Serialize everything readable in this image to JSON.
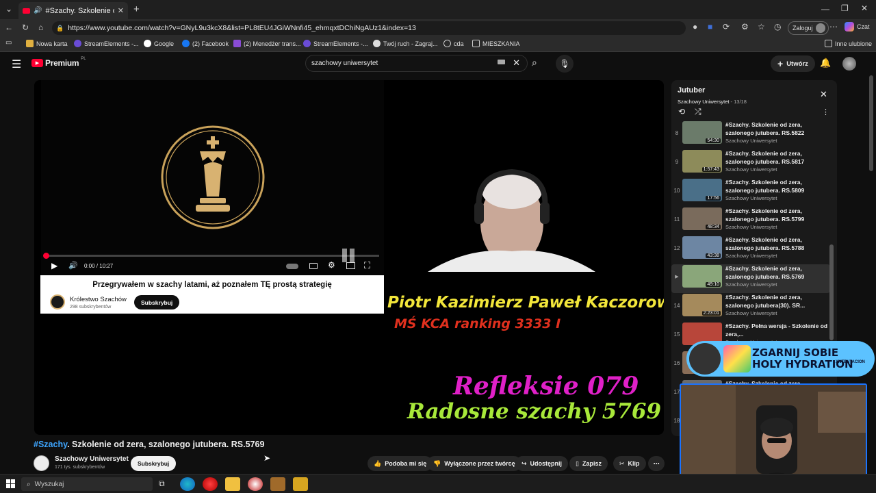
{
  "browser": {
    "tab_title": "#Szachy. Szkolenie od zera, sz",
    "url": "https://www.youtube.com/watch?v=GNyL9u3kcX8&list=PL8tEU4JGiWNnfi45_ehmqxtDChiNgAUz1&index=13",
    "profile_label": "Zaloguj",
    "copilot_label": "Czat",
    "bookmarks": [
      "Nowa karta",
      "StreamElements -...",
      "Google",
      "(2) Facebook",
      "(2) Menedżer trans...",
      "StreamElements -...",
      "Twój ruch - Zagraj...",
      "cda",
      "MIESZKANIA"
    ],
    "other_bookmarks": "Inne ulubione"
  },
  "youtube": {
    "logo_text": "Premium",
    "logo_region": "PL",
    "search_value": "szachowy uniwersytet",
    "create_label": "Utwórz"
  },
  "player": {
    "time": "0:00 / 10:27",
    "ad_headline": "Przegrywałem w szachy latami, aż poznałem TĘ prostą strategię",
    "ad_channel": "Królestwo Szachów",
    "ad_subs": "298 subskrybentów",
    "ad_subscribe": "Subskrybuj",
    "overlay_name": "Piotr Kazimierz Paweł Kaczorowski",
    "overlay_rank": "MŚ KCA ranking 3333 I",
    "overlay_series": "Refleksie 079",
    "overlay_title": "Radosne szachy 5769",
    "progress": 0.0
  },
  "video": {
    "hashtag": "#Szachy",
    "title_rest": ". Szkolenie od zera, szalonego jutubera. RS.5769",
    "channel": "Szachowy Uniwersytet",
    "subs": "171 tys. subskrybentów",
    "subscribe": "Subskrybuj",
    "actions": {
      "like": "Podoba mi się",
      "dislike": "Wyłączone przez twórcę",
      "share": "Udostępnij",
      "save": "Zapisz",
      "clip": "Klip"
    }
  },
  "playlist": {
    "title": "Jutuber",
    "subtitle": "Szachowy Uniwersytet",
    "position": "13/18",
    "items": [
      {
        "num": "8",
        "title": "#Szachy. Szkolenie od zera, szalonego jutubera. RS.5822",
        "channel": "Szachowy Uniwersytet",
        "duration": "54:30"
      },
      {
        "num": "9",
        "title": "#Szachy. Szkolenie od zera, szalonego jutubera. RS.5817",
        "channel": "Szachowy Uniwersytet",
        "duration": "1:57:43"
      },
      {
        "num": "10",
        "title": "#Szachy. Szkolenie od zera, szalonego jutubera. RS.5809",
        "channel": "Szachowy Uniwersytet",
        "duration": "17:56"
      },
      {
        "num": "11",
        "title": "#Szachy. Szkolenie od zera, szalonego jutubera. RS.5799",
        "channel": "Szachowy Uniwersytet",
        "duration": "48:34"
      },
      {
        "num": "12",
        "title": "#Szachy. Szkolenie od zera, szalonego jutubera. RS.5788",
        "channel": "Szachowy Uniwersytet",
        "duration": "43:38"
      },
      {
        "num": "▶",
        "title": "#Szachy. Szkolenie od zera, szalonego jutubera. RS.5769",
        "channel": "Szachowy Uniwersytet",
        "duration": "49:10"
      },
      {
        "num": "14",
        "title": "#Szachy. Szkolenie od zera, szalonego jutubera(30). SR...",
        "channel": "Szachowy Uniwersytet",
        "duration": "2:23:01"
      },
      {
        "num": "15",
        "title": "#Szachy. Pełna wersja - Szkolenie od zera,...",
        "channel": "Szachowy Uniwersytet",
        "duration": ""
      },
      {
        "num": "16",
        "title": "",
        "channel": "",
        "duration": ""
      },
      {
        "num": "17",
        "title": "#Szachy. Szkolenie od zera",
        "channel": "",
        "duration": ""
      },
      {
        "num": "18",
        "title": "",
        "channel": "",
        "duration": ""
      }
    ]
  },
  "promo": {
    "headline_1": "ZGARNIJ SOBIE",
    "headline_2": "HOLY HYDRATION",
    "tag": "XNTENTACION"
  },
  "taskbar": {
    "search_placeholder": "Wyszukaj"
  },
  "colors": {
    "youtube_red": "#ff0033",
    "name_yellow": "#f2e63a",
    "rank_red": "#e0301e",
    "series_magenta": "#e020c8",
    "title_green": "#a8e83a",
    "hashtag_blue": "#3ea6ff"
  }
}
